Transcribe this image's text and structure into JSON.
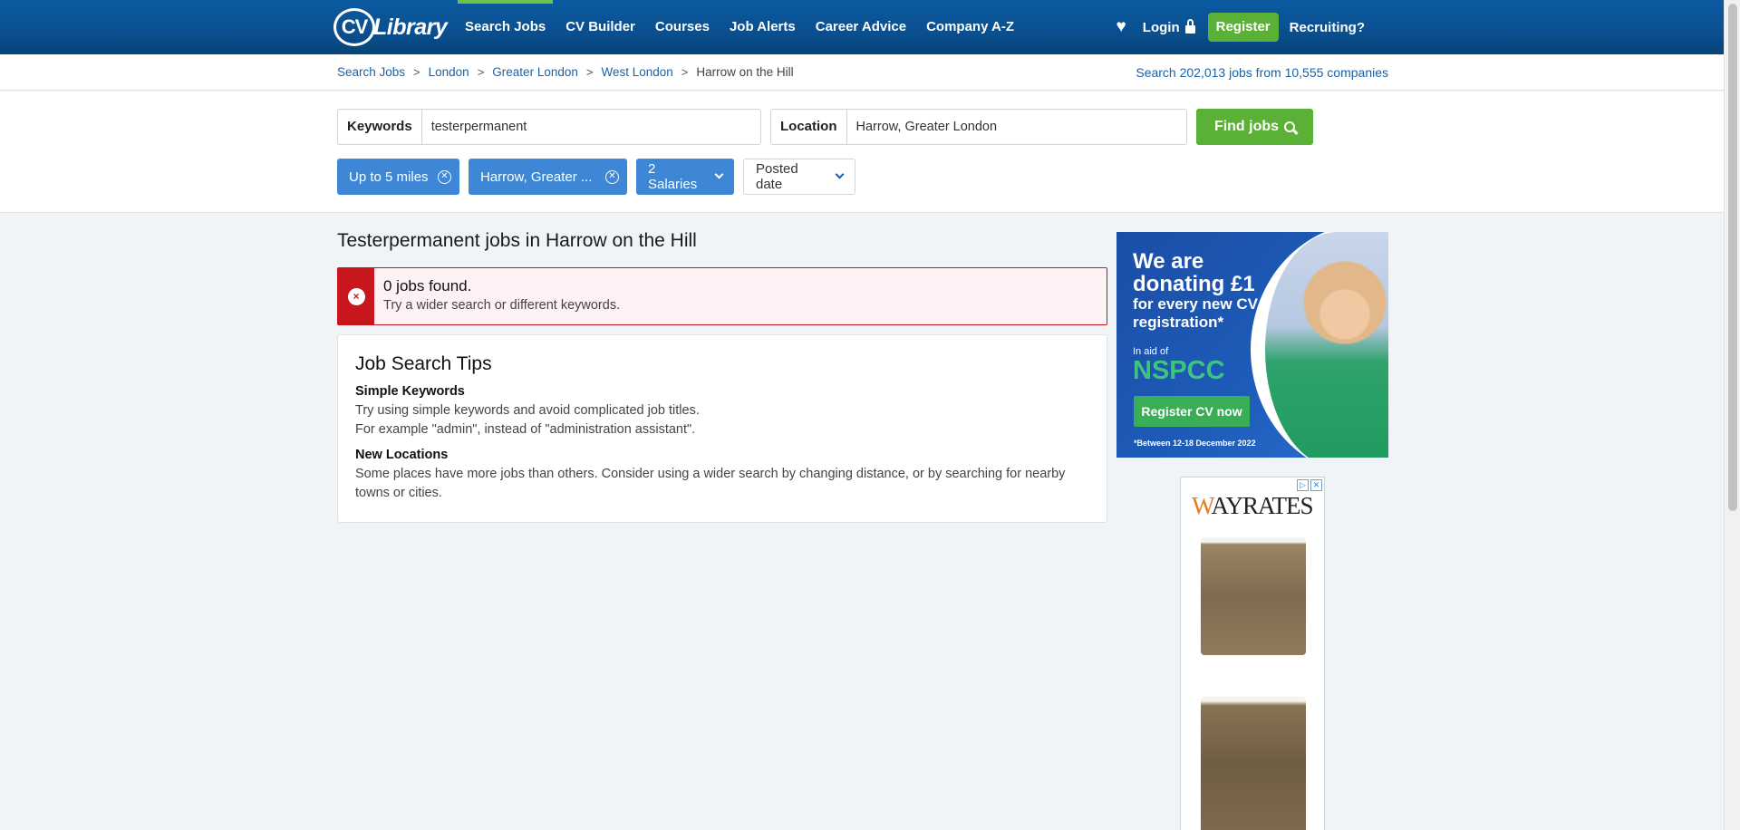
{
  "header": {
    "logo_cv": "CV",
    "logo_library": "Library",
    "nav": [
      "Search Jobs",
      "CV Builder",
      "Courses",
      "Job Alerts",
      "Career Advice",
      "Company A-Z"
    ],
    "login": "Login",
    "register": "Register",
    "recruiting": "Recruiting?"
  },
  "breadcrumb": {
    "items": [
      "Search Jobs",
      "London",
      "Greater London",
      "West London"
    ],
    "current": "Harrow on the Hill",
    "separator": ">"
  },
  "stats": {
    "prefix": "Search ",
    "jobs": "202,013 jobs",
    "middle": " from 10,555 ",
    "companies": "companies"
  },
  "search": {
    "keywords_label": "Keywords",
    "keywords_value": "testerpermanent",
    "location_label": "Location",
    "location_value": "Harrow, Greater London",
    "find_button": "Find jobs"
  },
  "filters": {
    "distance": "Up to 5 miles",
    "location": "Harrow, Greater ...",
    "salaries": "2 Salaries",
    "posted": "Posted date"
  },
  "results": {
    "title": "Testerpermanent jobs in Harrow on the Hill",
    "alert_title": "0 jobs found.",
    "alert_sub": "Try a wider search or different keywords."
  },
  "tips": {
    "title": "Job Search Tips",
    "sections": [
      {
        "heading": "Simple Keywords",
        "lines": [
          "Try using simple keywords and avoid complicated job titles.",
          "For example \"admin\", instead of \"administration assistant\"."
        ]
      },
      {
        "heading": "New Locations",
        "lines": [
          "Some places have more jobs than others. Consider using a wider search by changing distance, or by searching for nearby towns or cities."
        ]
      }
    ]
  },
  "ad_nspcc": {
    "line1": "We are",
    "line2": "donating £1",
    "line3": "for every new CV",
    "line4": "registration*",
    "in_aid": "In aid of",
    "brand": "NSPCC",
    "button": "Register CV now",
    "footnote": "*Between 12-18 December 2022"
  },
  "ad_wayrates": {
    "brand_w": "W",
    "brand_rest": "AYRATES"
  },
  "colors": {
    "header_blue": "#0a4f8f",
    "accent_green": "#5ab136",
    "filter_blue": "#3d87d6",
    "error_red": "#c8161d"
  }
}
